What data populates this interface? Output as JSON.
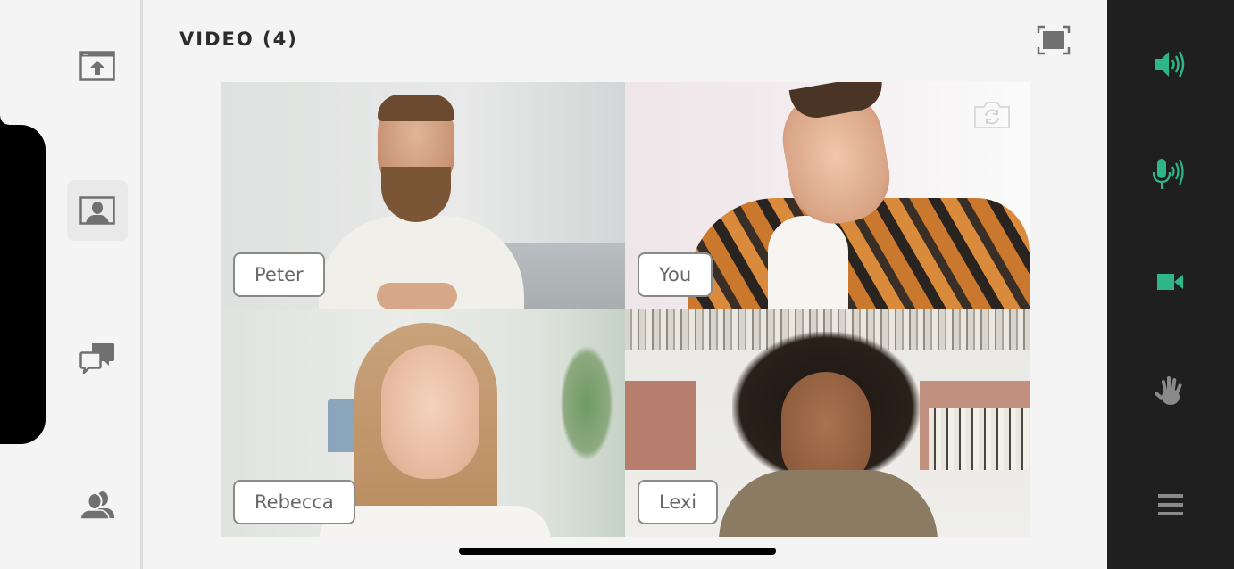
{
  "header": {
    "title": "VIDEO (4)"
  },
  "left_rail": {
    "items": [
      {
        "name": "share-screen",
        "icon": "upload-window-icon",
        "active": false
      },
      {
        "name": "video",
        "icon": "video-portrait-icon",
        "active": true
      },
      {
        "name": "chat",
        "icon": "chat-bubbles-icon",
        "active": false
      },
      {
        "name": "attendees",
        "icon": "people-icon",
        "active": false
      }
    ]
  },
  "video": {
    "participant_count": 4,
    "tiles": [
      {
        "name": "Peter",
        "self": false
      },
      {
        "name": "You",
        "self": true,
        "switch_camera_icon": "camera-switch-icon"
      },
      {
        "name": "Rebecca",
        "self": false
      },
      {
        "name": "Lexi",
        "self": false
      }
    ]
  },
  "controls": {
    "accent_color": "#2fb688",
    "inactive_color": "#8a8a8a",
    "items": [
      {
        "name": "speaker",
        "icon": "speaker-icon",
        "state": "on"
      },
      {
        "name": "microphone",
        "icon": "microphone-icon",
        "state": "on"
      },
      {
        "name": "camera",
        "icon": "video-camera-icon",
        "state": "on"
      },
      {
        "name": "raise-hand",
        "icon": "hand-icon",
        "state": "off"
      },
      {
        "name": "menu",
        "icon": "hamburger-menu-icon",
        "state": "off"
      }
    ]
  }
}
